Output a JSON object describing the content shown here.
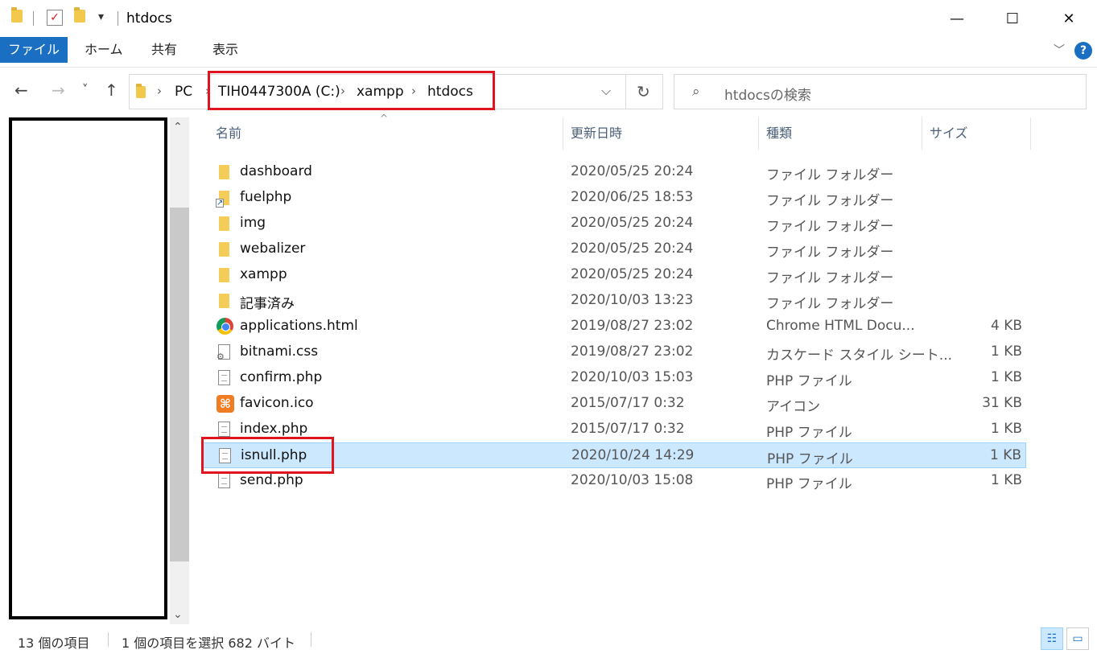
{
  "window": {
    "title": "htdocs",
    "minimize": "—",
    "maximize": "☐",
    "close": "✕"
  },
  "quick_access": {
    "dropdown": "▾"
  },
  "ribbon": {
    "tabs": [
      {
        "label": "ファイル"
      },
      {
        "label": "ホーム"
      },
      {
        "label": "共有"
      },
      {
        "label": "表示"
      }
    ],
    "expand": "﹀",
    "help": "?"
  },
  "nav": {
    "back": "←",
    "forward": "→",
    "recent": "˅",
    "up": "↑",
    "refresh": "↻",
    "dropdown": "⌵"
  },
  "address": {
    "parts": [
      "PC",
      "TIH0447300A (C:)",
      "xampp",
      "htdocs"
    ],
    "chevron": "›"
  },
  "search": {
    "placeholder": "htdocsの検索",
    "icon": "⌕"
  },
  "columns": {
    "name": "名前",
    "date": "更新日時",
    "type": "種類",
    "size": "サイズ",
    "sort": "^"
  },
  "files": [
    {
      "name": "dashboard",
      "date": "2020/05/25 20:24",
      "type": "ファイル フォルダー",
      "size": "",
      "icon": "folder-icon"
    },
    {
      "name": "fuelphp",
      "date": "2020/06/25 18:53",
      "type": "ファイル フォルダー",
      "size": "",
      "icon": "shortcut-folder-icon"
    },
    {
      "name": "img",
      "date": "2020/05/25 20:24",
      "type": "ファイル フォルダー",
      "size": "",
      "icon": "folder-icon"
    },
    {
      "name": "webalizer",
      "date": "2020/05/25 20:24",
      "type": "ファイル フォルダー",
      "size": "",
      "icon": "folder-icon"
    },
    {
      "name": "xampp",
      "date": "2020/05/25 20:24",
      "type": "ファイル フォルダー",
      "size": "",
      "icon": "folder-icon"
    },
    {
      "name": "記事済み",
      "date": "2020/10/03 13:23",
      "type": "ファイル フォルダー",
      "size": "",
      "icon": "folder-icon"
    },
    {
      "name": "applications.html",
      "date": "2019/08/27 23:02",
      "type": "Chrome HTML Docu...",
      "size": "4 KB",
      "icon": "chrome-icon"
    },
    {
      "name": "bitnami.css",
      "date": "2019/08/27 23:02",
      "type": "カスケード スタイル シート...",
      "size": "1 KB",
      "icon": "css-file-icon"
    },
    {
      "name": "confirm.php",
      "date": "2020/10/03 15:03",
      "type": "PHP ファイル",
      "size": "1 KB",
      "icon": "php-file-icon"
    },
    {
      "name": "favicon.ico",
      "date": "2015/07/17 0:32",
      "type": "アイコン",
      "size": "31 KB",
      "icon": "xampp-icon"
    },
    {
      "name": "index.php",
      "date": "2015/07/17 0:32",
      "type": "PHP ファイル",
      "size": "1 KB",
      "icon": "php-file-icon"
    },
    {
      "name": "isnull.php",
      "date": "2020/10/24 14:29",
      "type": "PHP ファイル",
      "size": "1 KB",
      "icon": "php-file-icon",
      "selected": true
    },
    {
      "name": "send.php",
      "date": "2020/10/03 15:08",
      "type": "PHP ファイル",
      "size": "1 KB",
      "icon": "php-file-icon"
    }
  ],
  "status": {
    "count": "13 個の項目",
    "selection": "1 個の項目を選択  682 バイト",
    "details_view": "☷",
    "tiles_view": "▭"
  },
  "colors": {
    "accent": "#1a6fc2",
    "selection": "#cce8ff",
    "highlight_box": "#e0141e"
  }
}
